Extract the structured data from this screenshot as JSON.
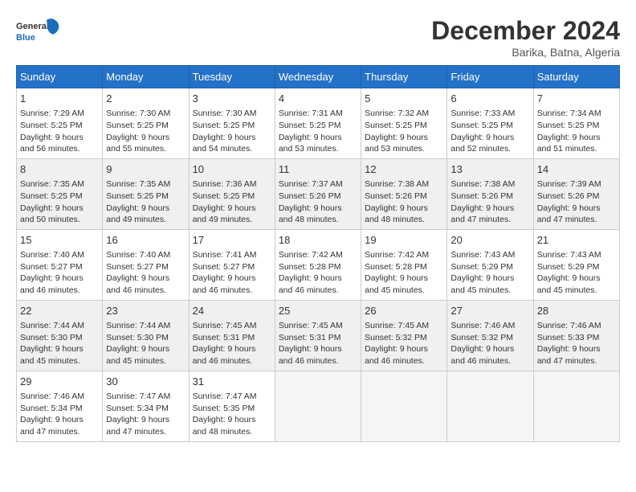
{
  "header": {
    "logo_general": "General",
    "logo_blue": "Blue",
    "month_title": "December 2024",
    "location": "Barika, Batna, Algeria"
  },
  "weekdays": [
    "Sunday",
    "Monday",
    "Tuesday",
    "Wednesday",
    "Thursday",
    "Friday",
    "Saturday"
  ],
  "weeks": [
    [
      {
        "day": "1",
        "lines": [
          "Sunrise: 7:29 AM",
          "Sunset: 5:25 PM",
          "Daylight: 9 hours",
          "and 56 minutes."
        ],
        "shaded": false
      },
      {
        "day": "2",
        "lines": [
          "Sunrise: 7:30 AM",
          "Sunset: 5:25 PM",
          "Daylight: 9 hours",
          "and 55 minutes."
        ],
        "shaded": false
      },
      {
        "day": "3",
        "lines": [
          "Sunrise: 7:30 AM",
          "Sunset: 5:25 PM",
          "Daylight: 9 hours",
          "and 54 minutes."
        ],
        "shaded": false
      },
      {
        "day": "4",
        "lines": [
          "Sunrise: 7:31 AM",
          "Sunset: 5:25 PM",
          "Daylight: 9 hours",
          "and 53 minutes."
        ],
        "shaded": false
      },
      {
        "day": "5",
        "lines": [
          "Sunrise: 7:32 AM",
          "Sunset: 5:25 PM",
          "Daylight: 9 hours",
          "and 53 minutes."
        ],
        "shaded": false
      },
      {
        "day": "6",
        "lines": [
          "Sunrise: 7:33 AM",
          "Sunset: 5:25 PM",
          "Daylight: 9 hours",
          "and 52 minutes."
        ],
        "shaded": false
      },
      {
        "day": "7",
        "lines": [
          "Sunrise: 7:34 AM",
          "Sunset: 5:25 PM",
          "Daylight: 9 hours",
          "and 51 minutes."
        ],
        "shaded": false
      }
    ],
    [
      {
        "day": "8",
        "lines": [
          "Sunrise: 7:35 AM",
          "Sunset: 5:25 PM",
          "Daylight: 9 hours",
          "and 50 minutes."
        ],
        "shaded": true
      },
      {
        "day": "9",
        "lines": [
          "Sunrise: 7:35 AM",
          "Sunset: 5:25 PM",
          "Daylight: 9 hours",
          "and 49 minutes."
        ],
        "shaded": true
      },
      {
        "day": "10",
        "lines": [
          "Sunrise: 7:36 AM",
          "Sunset: 5:25 PM",
          "Daylight: 9 hours",
          "and 49 minutes."
        ],
        "shaded": true
      },
      {
        "day": "11",
        "lines": [
          "Sunrise: 7:37 AM",
          "Sunset: 5:26 PM",
          "Daylight: 9 hours",
          "and 48 minutes."
        ],
        "shaded": true
      },
      {
        "day": "12",
        "lines": [
          "Sunrise: 7:38 AM",
          "Sunset: 5:26 PM",
          "Daylight: 9 hours",
          "and 48 minutes."
        ],
        "shaded": true
      },
      {
        "day": "13",
        "lines": [
          "Sunrise: 7:38 AM",
          "Sunset: 5:26 PM",
          "Daylight: 9 hours",
          "and 47 minutes."
        ],
        "shaded": true
      },
      {
        "day": "14",
        "lines": [
          "Sunrise: 7:39 AM",
          "Sunset: 5:26 PM",
          "Daylight: 9 hours",
          "and 47 minutes."
        ],
        "shaded": true
      }
    ],
    [
      {
        "day": "15",
        "lines": [
          "Sunrise: 7:40 AM",
          "Sunset: 5:27 PM",
          "Daylight: 9 hours",
          "and 46 minutes."
        ],
        "shaded": false
      },
      {
        "day": "16",
        "lines": [
          "Sunrise: 7:40 AM",
          "Sunset: 5:27 PM",
          "Daylight: 9 hours",
          "and 46 minutes."
        ],
        "shaded": false
      },
      {
        "day": "17",
        "lines": [
          "Sunrise: 7:41 AM",
          "Sunset: 5:27 PM",
          "Daylight: 9 hours",
          "and 46 minutes."
        ],
        "shaded": false
      },
      {
        "day": "18",
        "lines": [
          "Sunrise: 7:42 AM",
          "Sunset: 5:28 PM",
          "Daylight: 9 hours",
          "and 46 minutes."
        ],
        "shaded": false
      },
      {
        "day": "19",
        "lines": [
          "Sunrise: 7:42 AM",
          "Sunset: 5:28 PM",
          "Daylight: 9 hours",
          "and 45 minutes."
        ],
        "shaded": false
      },
      {
        "day": "20",
        "lines": [
          "Sunrise: 7:43 AM",
          "Sunset: 5:29 PM",
          "Daylight: 9 hours",
          "and 45 minutes."
        ],
        "shaded": false
      },
      {
        "day": "21",
        "lines": [
          "Sunrise: 7:43 AM",
          "Sunset: 5:29 PM",
          "Daylight: 9 hours",
          "and 45 minutes."
        ],
        "shaded": false
      }
    ],
    [
      {
        "day": "22",
        "lines": [
          "Sunrise: 7:44 AM",
          "Sunset: 5:30 PM",
          "Daylight: 9 hours",
          "and 45 minutes."
        ],
        "shaded": true
      },
      {
        "day": "23",
        "lines": [
          "Sunrise: 7:44 AM",
          "Sunset: 5:30 PM",
          "Daylight: 9 hours",
          "and 45 minutes."
        ],
        "shaded": true
      },
      {
        "day": "24",
        "lines": [
          "Sunrise: 7:45 AM",
          "Sunset: 5:31 PM",
          "Daylight: 9 hours",
          "and 46 minutes."
        ],
        "shaded": true
      },
      {
        "day": "25",
        "lines": [
          "Sunrise: 7:45 AM",
          "Sunset: 5:31 PM",
          "Daylight: 9 hours",
          "and 46 minutes."
        ],
        "shaded": true
      },
      {
        "day": "26",
        "lines": [
          "Sunrise: 7:45 AM",
          "Sunset: 5:32 PM",
          "Daylight: 9 hours",
          "and 46 minutes."
        ],
        "shaded": true
      },
      {
        "day": "27",
        "lines": [
          "Sunrise: 7:46 AM",
          "Sunset: 5:32 PM",
          "Daylight: 9 hours",
          "and 46 minutes."
        ],
        "shaded": true
      },
      {
        "day": "28",
        "lines": [
          "Sunrise: 7:46 AM",
          "Sunset: 5:33 PM",
          "Daylight: 9 hours",
          "and 47 minutes."
        ],
        "shaded": true
      }
    ],
    [
      {
        "day": "29",
        "lines": [
          "Sunrise: 7:46 AM",
          "Sunset: 5:34 PM",
          "Daylight: 9 hours",
          "and 47 minutes."
        ],
        "shaded": false
      },
      {
        "day": "30",
        "lines": [
          "Sunrise: 7:47 AM",
          "Sunset: 5:34 PM",
          "Daylight: 9 hours",
          "and 47 minutes."
        ],
        "shaded": false
      },
      {
        "day": "31",
        "lines": [
          "Sunrise: 7:47 AM",
          "Sunset: 5:35 PM",
          "Daylight: 9 hours",
          "and 48 minutes."
        ],
        "shaded": false
      },
      {
        "day": "",
        "lines": [],
        "shaded": true,
        "empty": true
      },
      {
        "day": "",
        "lines": [],
        "shaded": true,
        "empty": true
      },
      {
        "day": "",
        "lines": [],
        "shaded": true,
        "empty": true
      },
      {
        "day": "",
        "lines": [],
        "shaded": true,
        "empty": true
      }
    ]
  ]
}
